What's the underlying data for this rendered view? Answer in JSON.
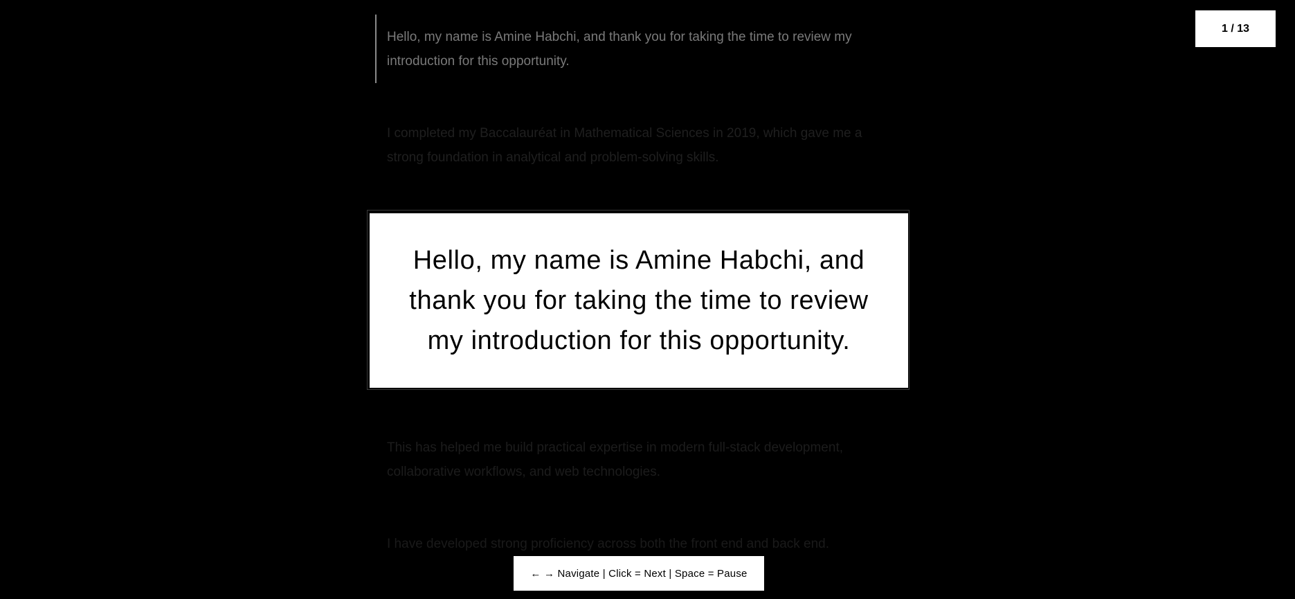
{
  "paragraphs": [
    "Hello, my name is Amine Habchi, and thank you for taking the time to review my introduction for this opportunity.",
    "I completed my Baccalauréat in Mathematical Sciences in 2019, which gave me a strong foundation in analytical and problem-solving skills.",
    "This has helped me build practical expertise in modern full-stack development, collaborative workflows, and web technologies.",
    "I have developed strong proficiency across both the front end and back end."
  ],
  "focus": {
    "text": "Hello, my name is Amine Habchi, and thank you for taking the time to review my introduction for this opportunity."
  },
  "counter": {
    "label": "1 / 13"
  },
  "hint": {
    "label": "← → Navigate | Click = Next | Space = Pause"
  },
  "colors": {
    "background": "#000000",
    "card": "#ffffff",
    "active_text": "#7a7a7a",
    "dim_text": "#1f1f1f"
  }
}
